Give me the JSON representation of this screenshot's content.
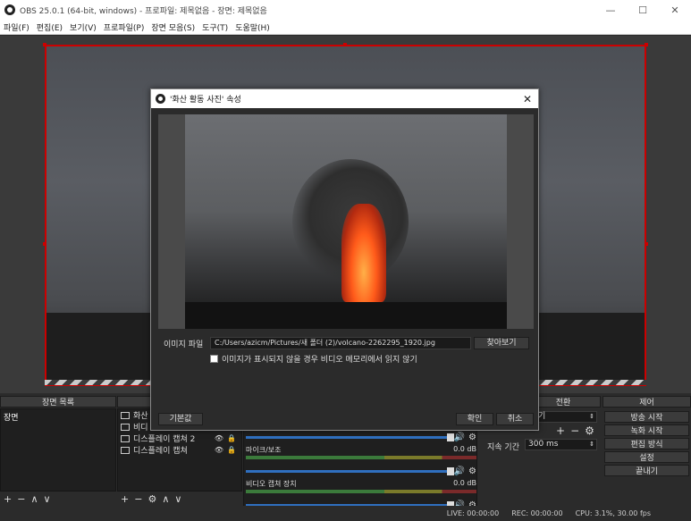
{
  "window": {
    "title": "OBS 25.0.1 (64-bit, windows) - 프로파일: 제목없음 - 장면: 제목없음",
    "minimize": "—",
    "maximize": "☐",
    "close": "✕"
  },
  "menu": {
    "items": [
      "파일(F)",
      "편집(E)",
      "보기(V)",
      "프로파일(P)",
      "장면 모음(S)",
      "도구(T)",
      "도움말(H)"
    ]
  },
  "docks": {
    "scenes": {
      "title": "장면 목록",
      "items": [
        "장면"
      ]
    },
    "sources": {
      "items": [
        {
          "label": "화산"
        },
        {
          "label": "비디"
        },
        {
          "label": "디스플레이 캡쳐 2"
        },
        {
          "label": "디스플레이 캡쳐"
        }
      ]
    },
    "mixer": {
      "channels": [
        {
          "label": "마이크/보조",
          "db": "0.0 dB"
        },
        {
          "label": "비디오 캡쳐 장치",
          "db": "0.0 dB"
        }
      ]
    },
    "transitions": {
      "title": "전환",
      "select_value": "기",
      "duration_label": "지속 기간",
      "duration_value": "300 ms"
    },
    "controls": {
      "title": "제어",
      "buttons": [
        "방송 시작",
        "녹화 시작",
        "편집 방식",
        "설정",
        "끝내기"
      ]
    }
  },
  "toolbar_glyphs": {
    "add": "+",
    "remove": "−",
    "settings": "⚙",
    "up": "∧",
    "down": "∨"
  },
  "status": {
    "live": "LIVE: 00:00:00",
    "rec": "REC: 00:00:00",
    "cpu": "CPU: 3.1%, 30.00 fps"
  },
  "dialog": {
    "title": "'화산 활동 사진' 속성",
    "close": "✕",
    "file_label": "이미지 파일",
    "file_path": "C:/Users/azicm/Pictures/새 폴더 (2)/volcano-2262295_1920.jpg",
    "browse_button": "찾아보기",
    "unload_checkbox": "이미지가 표시되지 않을 경우 비디오 메모리에서 읽지 않기",
    "defaults_button": "기본값",
    "ok_button": "확인",
    "cancel_button": "취소"
  }
}
